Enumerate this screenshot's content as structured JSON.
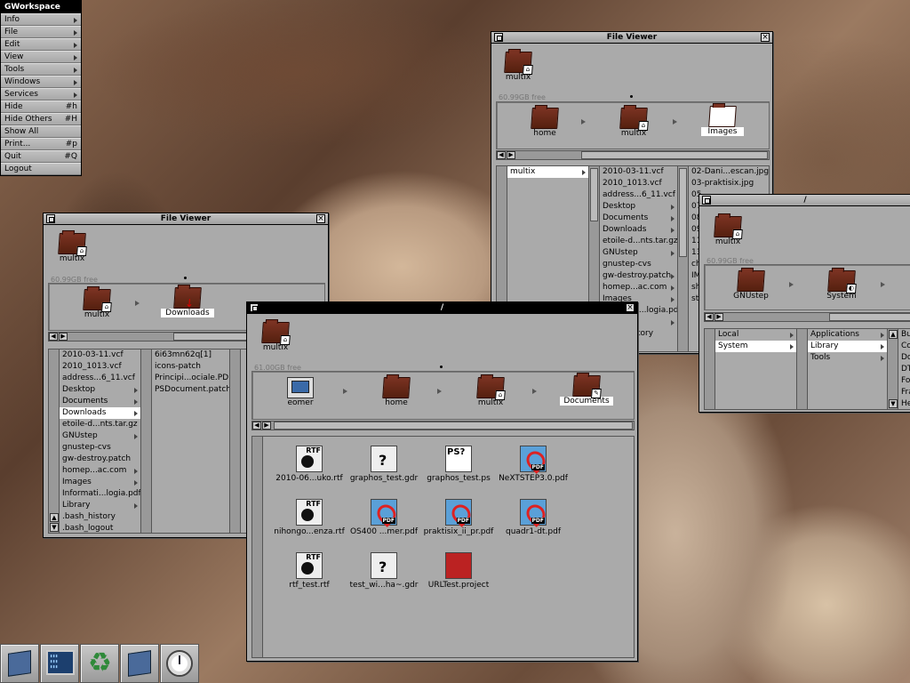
{
  "menu": {
    "title": "GWorkspace",
    "items": [
      {
        "label": "Info",
        "key": "",
        "sub": true
      },
      {
        "label": "File",
        "key": "",
        "sub": true
      },
      {
        "label": "Edit",
        "key": "",
        "sub": true
      },
      {
        "label": "View",
        "key": "",
        "sub": true
      },
      {
        "label": "Tools",
        "key": "",
        "sub": true
      },
      {
        "label": "Windows",
        "key": "",
        "sub": true
      },
      {
        "label": "Services",
        "key": "",
        "sub": true
      },
      {
        "label": "Hide",
        "key": "#h",
        "sub": false
      },
      {
        "label": "Hide Others",
        "key": "#H",
        "sub": false
      },
      {
        "label": "Show All",
        "key": "",
        "sub": false
      },
      {
        "label": "Print...",
        "key": "#p",
        "sub": false
      },
      {
        "label": "Quit",
        "key": "#Q",
        "sub": false
      },
      {
        "label": "Logout",
        "key": "",
        "sub": false
      }
    ]
  },
  "win1": {
    "title": "File Viewer",
    "top_icon": "multix",
    "free": "60.99GB free",
    "path": [
      "home",
      "multix",
      "Images"
    ],
    "col1": [
      "multix"
    ],
    "col2": [
      "2010-03-11.vcf",
      "2010_1013.vcf",
      "address...6_11.vcf",
      "Desktop",
      "Documents",
      "Downloads",
      "etoile-d...nts.tar.gz",
      "GNUstep",
      "gnustep-cvs",
      "gw-destroy.patch",
      "homep...ac.com",
      "Images",
      "Informati...logia.pdf",
      "Library",
      "bash_history"
    ],
    "col3": [
      "02-Dani...escan.jpg",
      "03-praktisix.jpg",
      "05",
      "07",
      "08",
      "09",
      "11",
      "13",
      "ch",
      "IM",
      "sh",
      "st"
    ]
  },
  "win2": {
    "title": "File Viewer",
    "top_icon": "multix",
    "free": "60.99GB free",
    "path": [
      "multix",
      "Downloads"
    ],
    "col1": [
      "2010-03-11.vcf",
      "2010_1013.vcf",
      "address...6_11.vcf",
      "Desktop",
      "Documents",
      "Downloads",
      "etoile-d...nts.tar.gz",
      "GNUstep",
      "gnustep-cvs",
      "gw-destroy.patch",
      "homep...ac.com",
      "Images",
      "Informati...logia.pdf",
      "Library",
      ".bash_history",
      ".bash_logout"
    ],
    "col2": [
      "6i63mn62q[1]",
      "icons-patch",
      "Principi...ociale.PDF",
      "PSDocument.patch"
    ]
  },
  "win3": {
    "title": "/",
    "top_icon": "multix",
    "free": "61.00GB free",
    "path": [
      "eomer",
      "home",
      "multix",
      "Documents"
    ],
    "files": [
      {
        "name": "2010-06...uko.rtf",
        "kind": "rtf",
        "tag": "RTF"
      },
      {
        "name": "graphos_test.gdr",
        "kind": "gdr",
        "tag": ""
      },
      {
        "name": "graphos_test.ps",
        "kind": "ps",
        "tag": "PS?"
      },
      {
        "name": "NeXTSTEP3.0.pdf",
        "kind": "pdf",
        "tag": "PDF"
      },
      {
        "name": "nihongo...enza.rtf",
        "kind": "rtf",
        "tag": "RTF"
      },
      {
        "name": "OS400 ...mer.pdf",
        "kind": "pdf",
        "tag": "PDF"
      },
      {
        "name": "praktisix_ii_pr.pdf",
        "kind": "pdf",
        "tag": "PDF"
      },
      {
        "name": "quadr1-dt.pdf",
        "kind": "pdf",
        "tag": "PDF"
      },
      {
        "name": "rtf_test.rtf",
        "kind": "rtf",
        "tag": "RTF"
      },
      {
        "name": "test_wi...ha~.gdr",
        "kind": "gdr",
        "tag": ""
      },
      {
        "name": "URLTest.project",
        "kind": "proj",
        "tag": ""
      }
    ]
  },
  "win4": {
    "title": "/",
    "top_icon": "multix",
    "free": "60.99GB free",
    "path": [
      "GNUstep",
      "System"
    ],
    "col1": [
      "Local",
      "System"
    ],
    "col2": [
      "Applications",
      "Library",
      "Tools"
    ],
    "col3": [
      "Bu",
      "Co",
      "Do",
      "DT",
      "Fo",
      "Fra",
      "He"
    ]
  },
  "dock": [
    "gnustep-app-icon",
    "terminal-icon",
    "recycler-icon",
    "gnustep-app-icon",
    "clock-icon"
  ]
}
